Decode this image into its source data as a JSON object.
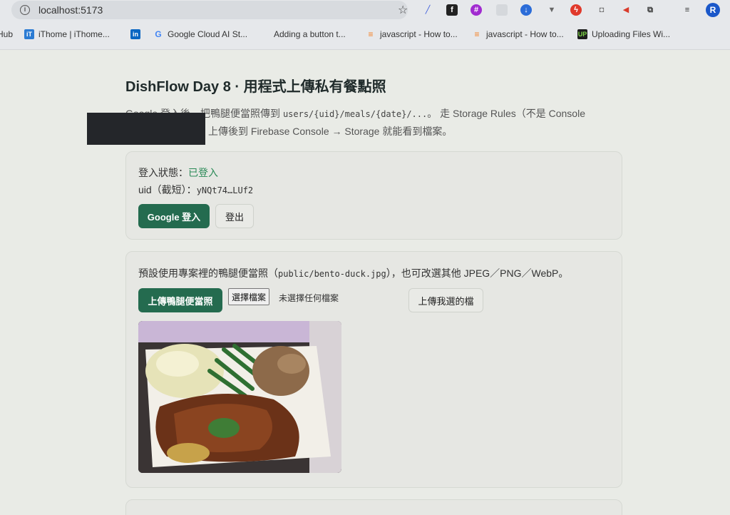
{
  "browser": {
    "url": "localhost:5173",
    "bookmarks": [
      {
        "label": "Hub"
      },
      {
        "label": "iThome | iThome..."
      },
      {
        "label": ""
      },
      {
        "label": "Google Cloud AI St..."
      },
      {
        "label": "Adding a button t..."
      },
      {
        "label": "javascript - How to..."
      },
      {
        "label": "javascript - How to..."
      },
      {
        "label": "Uploading Files Wi..."
      }
    ],
    "avatar_letter": "R"
  },
  "page": {
    "title": "DishFlow Day 8 · 用程式上傳私有餐點照",
    "desc": {
      "part1": "Google 登入後，把鴨腿便當照傳到 ",
      "path": "users/{uid}/meals/{date}/...",
      "part2": "。 走 Storage Rules（不是 Console",
      "line2": "上傳後到 Firebase Console → Storage 就能看到檔案。"
    }
  },
  "auth": {
    "status_label": "登入狀態：",
    "status_value": "已登入",
    "uid_label": "uid（截短）：",
    "uid_value": "yNQt74…LUf2",
    "login_button": "Google 登入",
    "logout_button": "登出"
  },
  "upload": {
    "intro_part1": "預設使用專案裡的鴨腿便當照（",
    "intro_path": "public/bento-duck.jpg",
    "intro_part2": "），也可改選其他 JPEG／PNG／WebP。",
    "upload_default_button": "上傳鴨腿便當照",
    "choose_file_button": "選擇檔案",
    "file_status": "未選擇任何檔案",
    "upload_selected_button": "上傳我選的檔"
  }
}
